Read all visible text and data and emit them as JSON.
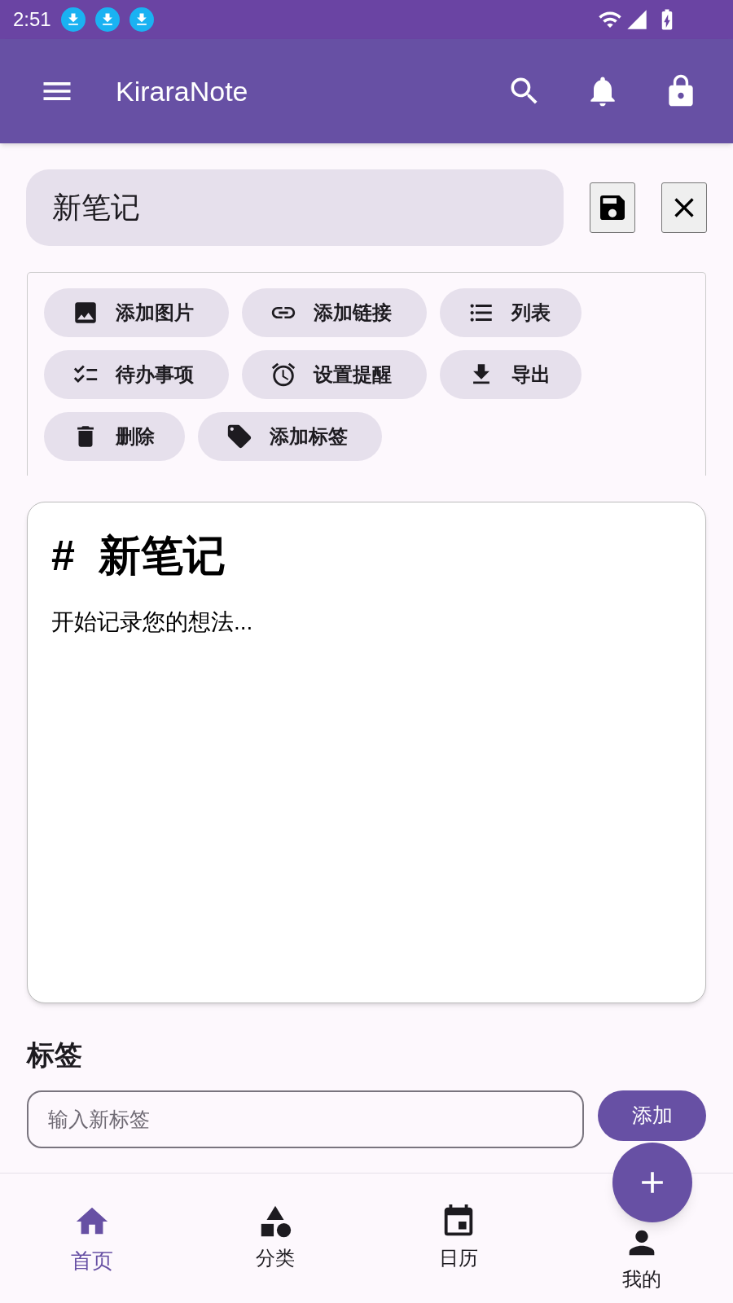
{
  "status_bar": {
    "time": "2:51"
  },
  "app_bar": {
    "title": "KiraraNote"
  },
  "title_field": {
    "value": "新笔记"
  },
  "toolbar": {
    "chips": [
      {
        "label": "添加图片"
      },
      {
        "label": "添加链接"
      },
      {
        "label": "列表"
      },
      {
        "label": "待办事项"
      },
      {
        "label": "设置提醒"
      },
      {
        "label": "导出"
      },
      {
        "label": "删除"
      },
      {
        "label": "添加标签"
      }
    ]
  },
  "editor": {
    "heading": "#  新笔记",
    "body": "开始记录您的想法..."
  },
  "tags": {
    "title": "标签",
    "placeholder": "输入新标签",
    "add_button": "添加"
  },
  "bottom_nav": [
    {
      "label": "首页",
      "selected": true
    },
    {
      "label": "分类",
      "selected": false
    },
    {
      "label": "日历",
      "selected": false
    },
    {
      "label": "我的",
      "selected": false
    }
  ]
}
